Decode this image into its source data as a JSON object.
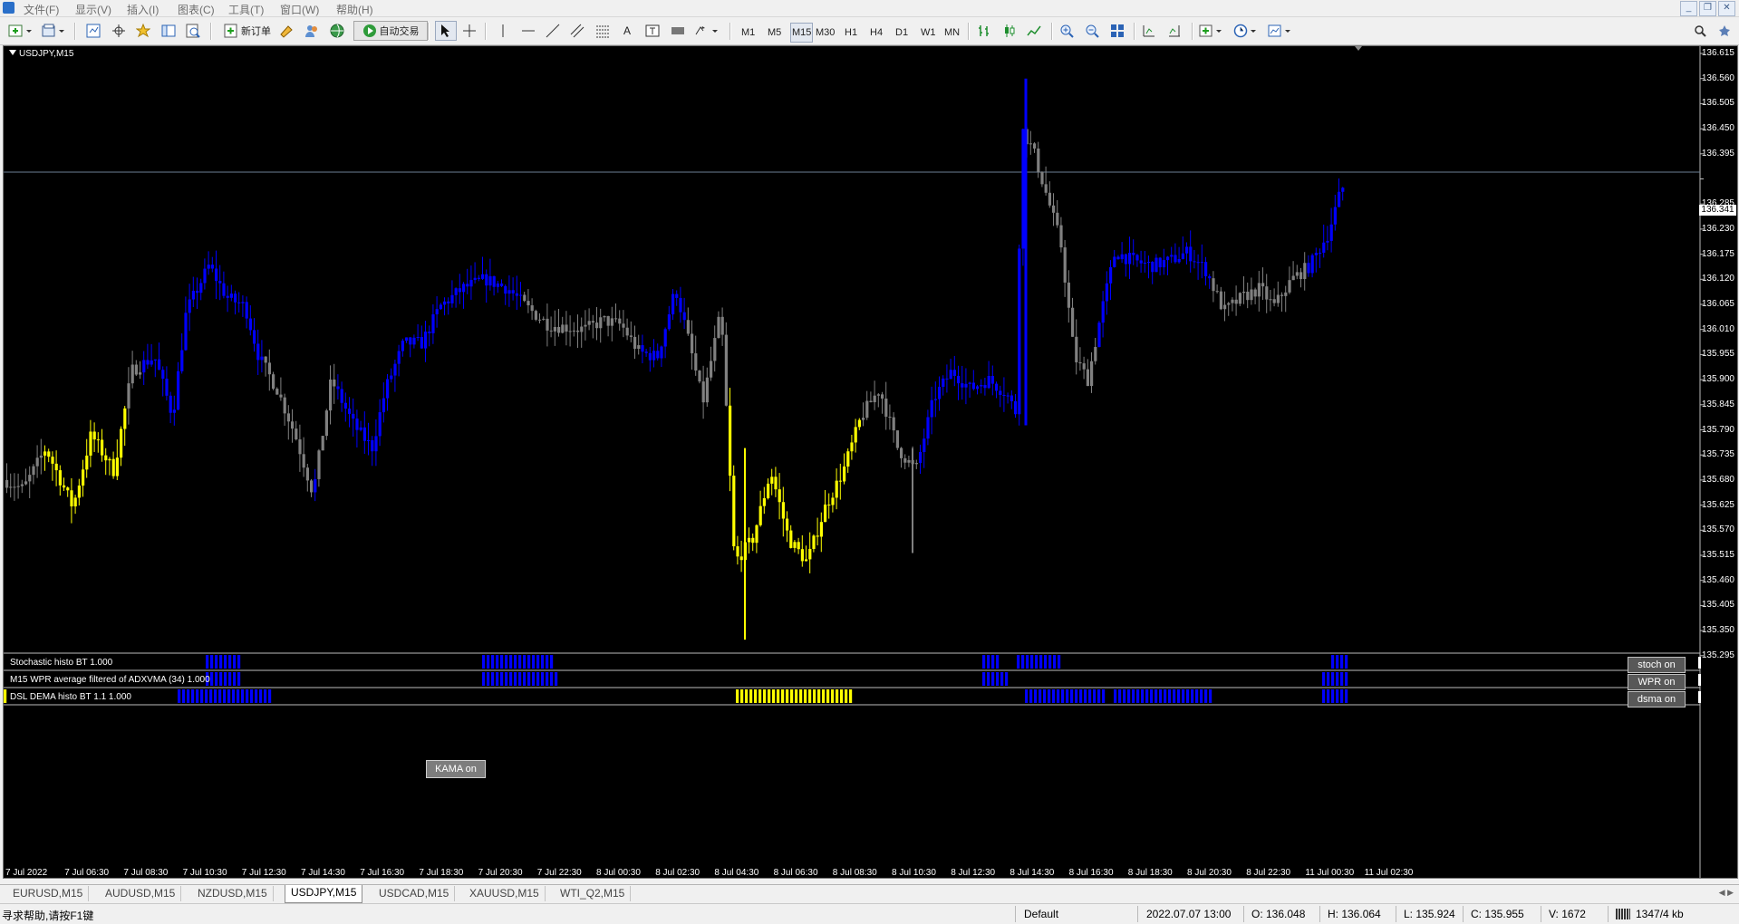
{
  "menu": {
    "items": [
      "文件(F)",
      "显示(V)",
      "插入(I)",
      "图表(C)",
      "工具(T)",
      "窗口(W)",
      "帮助(H)"
    ]
  },
  "toolbar": {
    "new_order_label": "新订单",
    "auto_trading_label": "自动交易",
    "timeframes": [
      "M1",
      "M5",
      "M15",
      "M30",
      "H1",
      "H4",
      "D1",
      "W1",
      "MN"
    ],
    "active_timeframe": "M15"
  },
  "chart": {
    "title": "USDJPY,M15",
    "current_price_label": "136.341",
    "price_axis": [
      "136.615",
      "136.560",
      "136.505",
      "136.450",
      "136.395",
      "136.341",
      "136.285",
      "136.230",
      "136.175",
      "136.120",
      "136.065",
      "136.010",
      "135.955",
      "135.900",
      "135.845",
      "135.790",
      "135.735",
      "135.680",
      "135.625",
      "135.570",
      "135.515",
      "135.460",
      "135.405",
      "135.350",
      "135.295"
    ],
    "time_axis": [
      "7 Jul 2022",
      "7 Jul 06:30",
      "7 Jul 08:30",
      "7 Jul 10:30",
      "7 Jul 12:30",
      "7 Jul 14:30",
      "7 Jul 16:30",
      "7 Jul 18:30",
      "7 Jul 20:30",
      "7 Jul 22:30",
      "8 Jul 00:30",
      "8 Jul 02:30",
      "8 Jul 04:30",
      "8 Jul 06:30",
      "8 Jul 08:30",
      "8 Jul 10:30",
      "8 Jul 12:30",
      "8 Jul 14:30",
      "8 Jul 16:30",
      "8 Jul 18:30",
      "8 Jul 20:30",
      "8 Jul 22:30",
      "11 Jul 00:30",
      "11 Jul 02:30"
    ],
    "kama_button": "KAMA on",
    "colors": {
      "bull_trend": "#0000ff",
      "bear_trend": "#ffff00",
      "neutral": "#808080",
      "background": "#000000"
    },
    "indicators": [
      {
        "label": "Stochastic histo BT 1.000",
        "button": "stoch on"
      },
      {
        "label": "M15  WPR average filtered of ADXVMA (34) 1.000",
        "button": "WPR on"
      },
      {
        "label": "DSL DEMA histo BT 1.1 1.000",
        "button": "dsma on"
      }
    ]
  },
  "tabs": {
    "items": [
      "EURUSD,M15",
      "AUDUSD,M15",
      "NZDUSD,M15",
      "USDJPY,M15",
      "USDCAD,M15",
      "XAUUSD,M15",
      "WTI_Q2,M15"
    ],
    "active": "USDJPY,M15"
  },
  "status": {
    "help": "寻求帮助,请按F1键",
    "profile": "Default",
    "datetime": "2022.07.07 13:00",
    "open": "O: 136.048",
    "high": "H: 136.064",
    "low": "L: 135.924",
    "close": "C: 135.955",
    "volume": "V: 1672",
    "traffic": "1347/4 kb"
  }
}
